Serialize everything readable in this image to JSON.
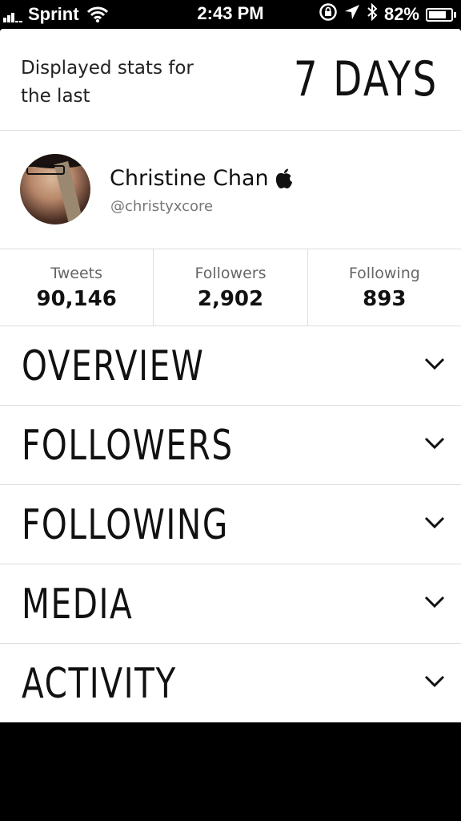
{
  "status_bar": {
    "carrier": "Sprint",
    "time": "2:43 PM",
    "battery_percent": "82%",
    "battery_level": 0.82,
    "icons": [
      "signal-icon",
      "wifi-icon",
      "rotation-lock-icon",
      "location-icon",
      "bluetooth-icon",
      "battery-icon"
    ]
  },
  "header": {
    "label": "Displayed stats for the last",
    "range": "7 DAYS"
  },
  "profile": {
    "name": "Christine Chan",
    "handle": "@christyxcore",
    "badge_icon": "apple-icon"
  },
  "stats": [
    {
      "label": "Tweets",
      "value": "90,146"
    },
    {
      "label": "Followers",
      "value": "2,902"
    },
    {
      "label": "Following",
      "value": "893"
    }
  ],
  "sections": [
    {
      "title": "OVERVIEW"
    },
    {
      "title": "FOLLOWERS"
    },
    {
      "title": "FOLLOWING"
    },
    {
      "title": "MEDIA"
    },
    {
      "title": "ACTIVITY"
    }
  ],
  "colors": {
    "background": "#ffffff",
    "divider": "#dedede",
    "text": "#111111",
    "muted": "#777777"
  }
}
